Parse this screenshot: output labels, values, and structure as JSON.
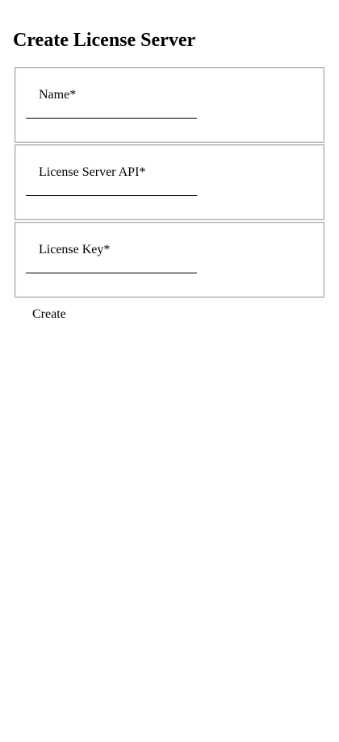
{
  "page": {
    "title": "Create License Server"
  },
  "form": {
    "fields": [
      {
        "label": "Name*",
        "value": ""
      },
      {
        "label": "License Server API*",
        "value": ""
      },
      {
        "label": "License Key*",
        "value": ""
      }
    ],
    "submit_label": "Create"
  }
}
